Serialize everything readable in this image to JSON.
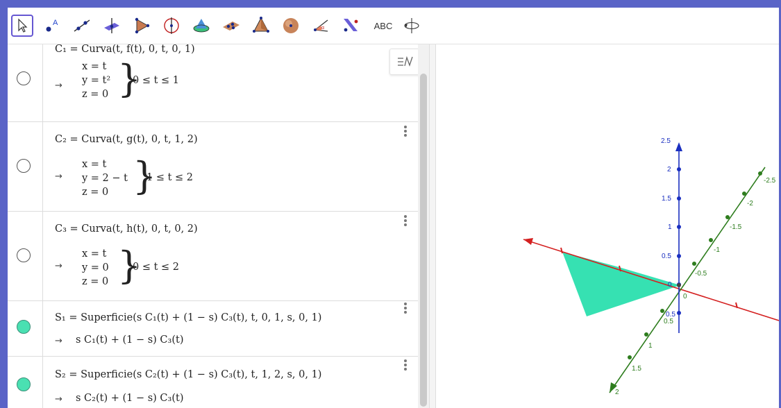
{
  "toolbar": {
    "tools": [
      {
        "name": "move-tool-icon",
        "label": ""
      },
      {
        "name": "point-tool-icon",
        "label": ""
      },
      {
        "name": "line-tool-icon",
        "label": ""
      },
      {
        "name": "perpendicular-plane-tool-icon",
        "label": ""
      },
      {
        "name": "polygon-tool-icon",
        "label": ""
      },
      {
        "name": "circle-axis-tool-icon",
        "label": ""
      },
      {
        "name": "intersect-surfaces-tool-icon",
        "label": ""
      },
      {
        "name": "plane-three-points-tool-icon",
        "label": ""
      },
      {
        "name": "pyramid-tool-icon",
        "label": ""
      },
      {
        "name": "sphere-tool-icon",
        "label": ""
      },
      {
        "name": "angle-tool-icon",
        "label": ""
      },
      {
        "name": "reflect-tool-icon",
        "label": ""
      },
      {
        "name": "text-tool",
        "label": "ABC"
      },
      {
        "name": "rotate-view-tool-icon",
        "label": ""
      }
    ]
  },
  "algebra": {
    "rows": [
      {
        "definition": "C₁ = Curva(t, f(t), 0, t, 0, 1)",
        "x": "x = t",
        "y": "y = t²",
        "z": "z = 0",
        "range": "0 ≤ t ≤ 1",
        "visible": false
      },
      {
        "definition": "C₂ = Curva(t, g(t), 0, t, 1, 2)",
        "x": "x = t",
        "y": "y = 2 − t",
        "z": "z = 0",
        "range": "1 ≤ t ≤ 2",
        "visible": false
      },
      {
        "definition": "C₃ = Curva(t, h(t), 0, t, 0, 2)",
        "x": "x = t",
        "y": "y = 0",
        "z": "z = 0",
        "range": "0 ≤ t ≤ 2",
        "visible": false
      },
      {
        "definition": "S₁ = Superficie(s C₁(t) + (1 − s) C₃(t), t, 0, 1, s, 0, 1)",
        "result": "s C₁(t) + (1 − s) C₃(t)",
        "visible": true
      },
      {
        "definition": "S₂ = Superficie(s C₂(t) + (1 − s) C₃(t), t, 1, 2, s, 0, 1)",
        "result": "s C₂(t) + (1 − s) C₃(t)",
        "visible": true
      }
    ],
    "arrow": "→"
  },
  "graphics3d": {
    "z_ticks": [
      "2.5",
      "2",
      "1.5",
      "1",
      "0.5",
      "0",
      "0.5"
    ],
    "y_ticks_back": [
      "-2.5",
      "-2",
      "-1.5",
      "-1",
      "-0.5"
    ],
    "y_ticks_front": [
      "0",
      "1",
      "1.5",
      "2"
    ],
    "x_tick": "0.5",
    "colors": {
      "x_axis": "#d42020",
      "y_axis": "#2e7d1e",
      "z_axis": "#1a2fc0",
      "surface": "#36e1b2"
    }
  }
}
